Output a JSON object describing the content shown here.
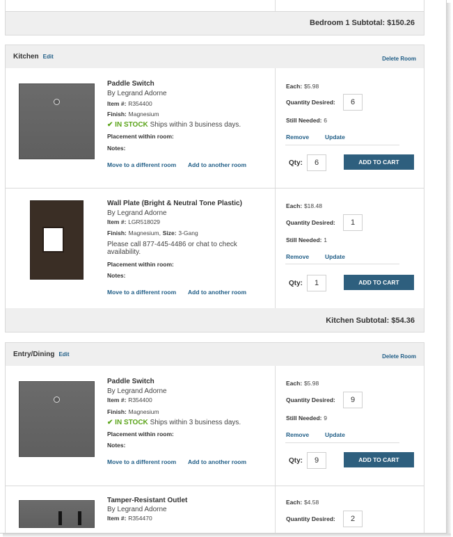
{
  "bedroom1": {
    "subtotal_label": "Bedroom 1 Subtotal:",
    "subtotal_value": "$150.26"
  },
  "labels": {
    "edit": "Edit",
    "delete_room": "Delete Room",
    "by": "By Legrand Adorne",
    "item_no": "Item #:",
    "finish": "Finish:",
    "size": "Size:",
    "in_stock": "IN STOCK",
    "ships": "Ships within 3 business days.",
    "placement": "Placement within room:",
    "notes": "Notes:",
    "move": "Move to a different room",
    "add_another": "Add to another room",
    "each": "Each:",
    "qty_desired": "Quantity Desired:",
    "still_needed": "Still Needed:",
    "remove": "Remove",
    "update": "Update",
    "qty": "Qty:",
    "add_to_cart": "ADD TO CART",
    "check_icon": "✔"
  },
  "kitchen": {
    "name": "Kitchen",
    "subtotal_label": "Kitchen Subtotal:",
    "subtotal_value": "$54.36",
    "items": [
      {
        "name": "Paddle Switch",
        "item_no": "R354400",
        "finish": "Magnesium",
        "each": "$5.98",
        "desired": "6",
        "still_needed": "6",
        "qty": "6",
        "image": "paddle-switch-image"
      },
      {
        "name": "Wall Plate (Bright & Neutral Tone Plastic)",
        "item_no": "LGR518029",
        "finish": "Magnesium,",
        "size": "3-Gang",
        "message": "Please call 877-445-4486 or chat to check availability.",
        "each": "$18.48",
        "desired": "1",
        "still_needed": "1",
        "qty": "1",
        "image": "wall-plate-image"
      }
    ]
  },
  "entry": {
    "name": "Entry/Dining",
    "items": [
      {
        "name": "Paddle Switch",
        "item_no": "R354400",
        "finish": "Magnesium",
        "each": "$5.98",
        "desired": "9",
        "still_needed": "9",
        "qty": "9",
        "image": "paddle-switch-image"
      },
      {
        "name": "Tamper-Resistant Outlet",
        "item_no": "R354470",
        "each": "$4.58",
        "desired": "2",
        "image": "outlet-image"
      }
    ]
  }
}
